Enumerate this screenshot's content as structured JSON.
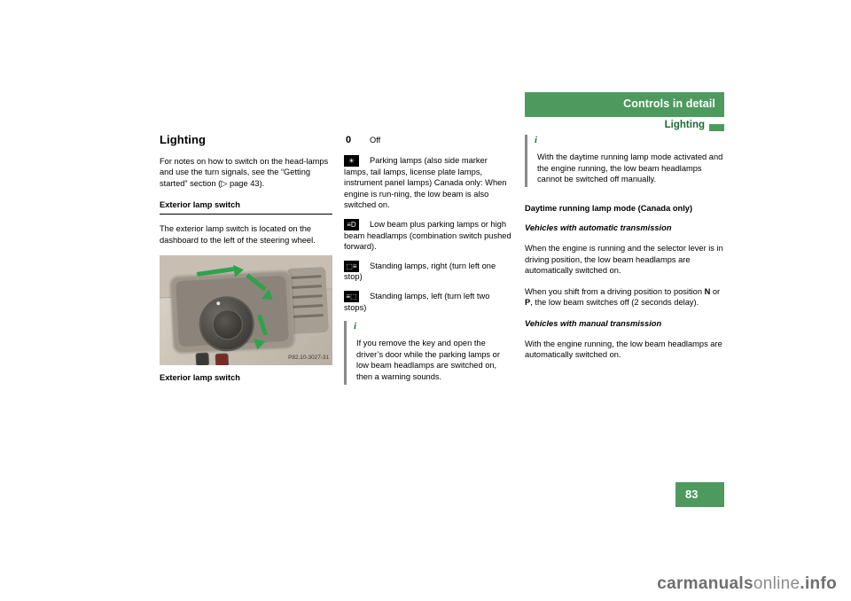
{
  "header": {
    "title": "Controls in detail",
    "subtitle": "Lighting",
    "page_number": "83",
    "bar_color": "#4e9a5e",
    "subtitle_color": "#1b6b33"
  },
  "col1": {
    "section_title": "Lighting",
    "intro": "For notes on how to switch on the head-lamps and use the turn signals, see the “Getting started” section (▷ page 43).",
    "sub_heading": "Exterior lamp switch",
    "sub_text": "The exterior lamp switch is located on the dashboard to the left of the steering wheel.",
    "figure_code": "P82.10-3027-31",
    "figure_caption": "Exterior lamp switch"
  },
  "col2": {
    "symbols": [
      {
        "glyph": "0",
        "style": "plain",
        "text": "Off"
      },
      {
        "glyph": "☀",
        "style": "box",
        "text": "Parking lamps (also side marker lamps, tail lamps, license plate lamps, instrument panel lamps) Canada only: When engine is run-ning, the low beam is also switched on."
      },
      {
        "glyph": "≡D",
        "style": "box",
        "text": "Low beam plus parking lamps or high beam headlamps (combination switch pushed forward)."
      },
      {
        "glyph": "⬚≡",
        "style": "box",
        "text": "Standing lamps, right (turn left one stop)"
      },
      {
        "glyph": "≡⬚",
        "style": "box",
        "text": "Standing lamps, left (turn left two stops)"
      }
    ],
    "note": {
      "icon": "i",
      "text": "If you remove the key and open the driver’s door while the parking lamps or low beam headlamps are switched on, then a warning sounds."
    }
  },
  "col3": {
    "note": {
      "icon": "i",
      "text": "With the daytime running lamp mode activated and the engine running, the low beam headlamps cannot be switched off manually."
    },
    "heading_main": "Daytime running lamp mode (Canada only)",
    "heading_auto": "Vehicles with automatic transmission",
    "para_auto_1": "When the engine is running and the selector lever is in driving position, the low beam headlamps are automatically switched on.",
    "para_auto_2_a": "When you shift from a driving position to position ",
    "para_auto_2_n": "N",
    "para_auto_2_b": " or ",
    "para_auto_2_p": "P",
    "para_auto_2_c": ", the low beam switches off (2 seconds delay).",
    "heading_manual": "Vehicles with manual transmission",
    "para_manual": "With the engine running, the low beam headlamps are automatically switched on."
  },
  "footer": {
    "watermark_prefix": "carmanuals",
    "watermark_mid": "online",
    "watermark_suffix": ".info"
  }
}
